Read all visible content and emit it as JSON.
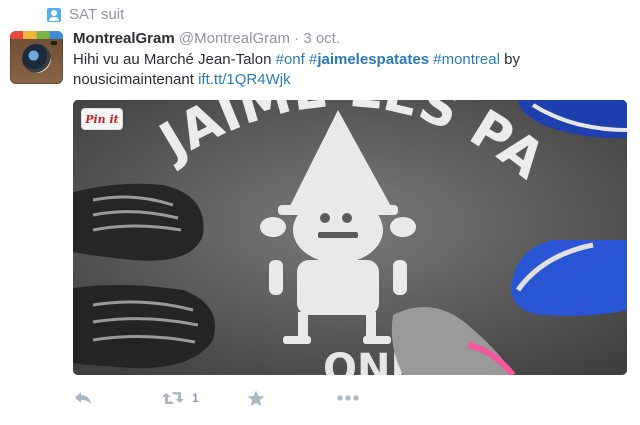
{
  "context": {
    "label": "SAT suit",
    "icon": "user-icon"
  },
  "tweet": {
    "avatar_icon": "instagram-icon",
    "name": "MontrealGram",
    "handle": "@MontrealGram",
    "separator": "·",
    "time": "3 oct.",
    "text_parts": [
      {
        "text": "Hihi vu au Marché Jean-Talon ",
        "type": "plain"
      },
      {
        "text": "#onf",
        "type": "link"
      },
      {
        "text": " ",
        "type": "plain"
      },
      {
        "text": "#",
        "type": "link"
      },
      {
        "text": "jaimelespatates",
        "type": "link-bold"
      },
      {
        "text": " ",
        "type": "plain"
      },
      {
        "text": "#montreal",
        "type": "link"
      },
      {
        "text": " by nousicimaintenant ",
        "type": "plain"
      },
      {
        "text": "ift.tt/1QR4Wjk",
        "type": "link"
      }
    ],
    "media": {
      "pinit_label": "Pin it",
      "stencil_text_top": "JAIME LES PATATES",
      "stencil_text_bottom": "ONFGA"
    },
    "actions": {
      "reply_icon": "reply-icon",
      "retweet_icon": "retweet-icon",
      "retweet_count": "1",
      "favorite_icon": "star-icon",
      "more_icon": "more-icon"
    }
  },
  "colors": {
    "link": "#2b7bb9",
    "muted": "#8899a6",
    "text": "#292f33",
    "icon": "#aab8c2",
    "context_icon": "#55acee"
  }
}
